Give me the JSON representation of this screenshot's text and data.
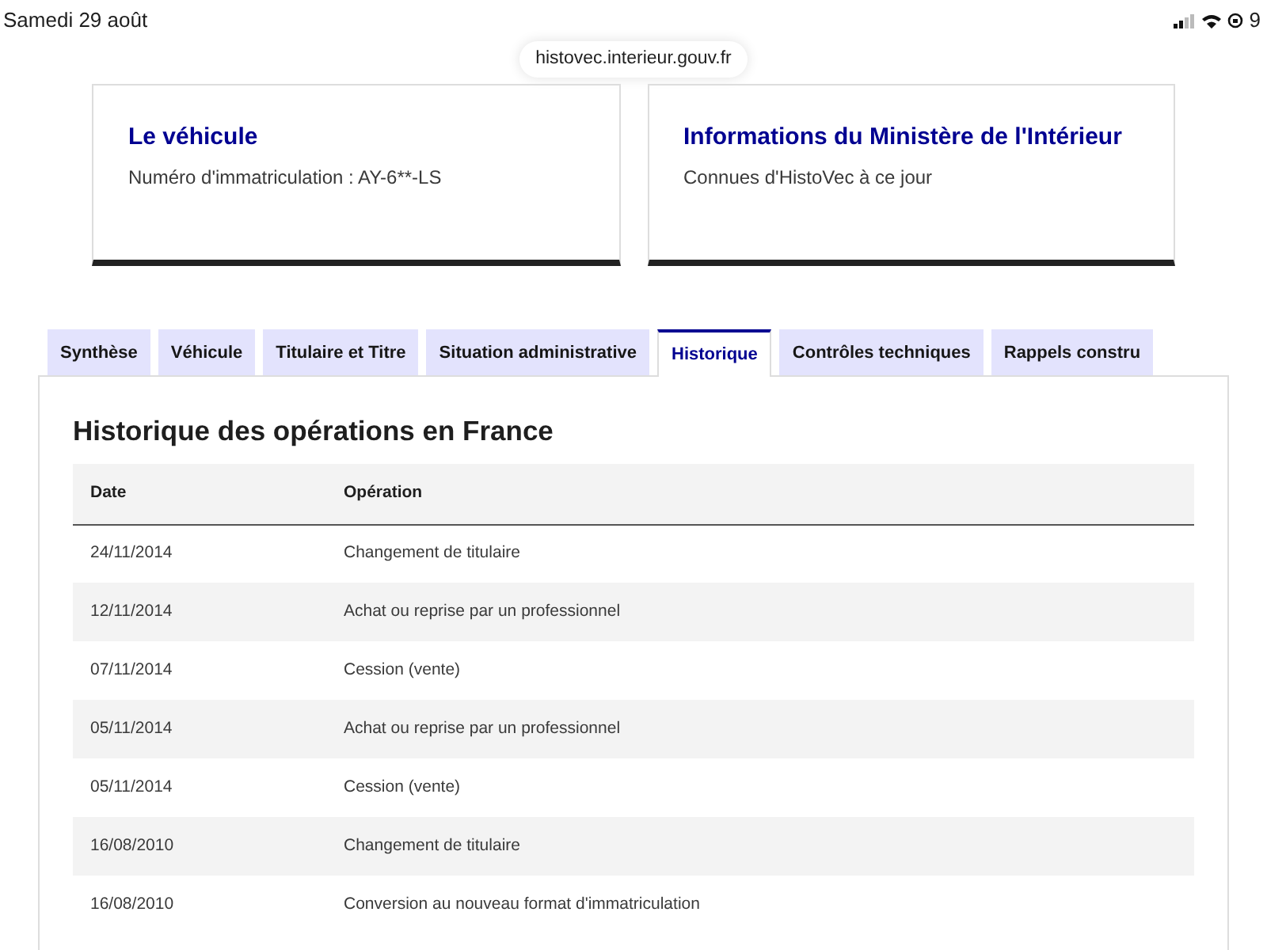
{
  "status_bar": {
    "date": "Samedi 29 août",
    "battery": "9"
  },
  "address_bar": {
    "url": "histovec.interieur.gouv.fr"
  },
  "cards": [
    {
      "title": "Le véhicule",
      "text": "Numéro d'immatriculation : AY-6**-LS"
    },
    {
      "title": "Informations du Ministère de l'Intérieur",
      "text": "Connues d'HistoVec à ce jour"
    }
  ],
  "tabs": [
    {
      "label": "Synthèse",
      "selected": false
    },
    {
      "label": "Véhicule",
      "selected": false
    },
    {
      "label": "Titulaire et Titre",
      "selected": false
    },
    {
      "label": "Situation administrative",
      "selected": false
    },
    {
      "label": "Historique",
      "selected": true
    },
    {
      "label": "Contrôles techniques",
      "selected": false
    },
    {
      "label": "Rappels constru",
      "selected": false
    }
  ],
  "section": {
    "title": "Historique des opérations en France"
  },
  "table": {
    "columns": [
      "Date",
      "Opération"
    ],
    "rows": [
      [
        "24/11/2014",
        "Changement de titulaire"
      ],
      [
        "12/11/2014",
        "Achat ou reprise par un professionnel"
      ],
      [
        "07/11/2014",
        "Cession (vente)"
      ],
      [
        "05/11/2014",
        "Achat ou reprise par un professionnel"
      ],
      [
        "05/11/2014",
        "Cession (vente)"
      ],
      [
        "16/08/2010",
        "Changement de titulaire"
      ],
      [
        "16/08/2010",
        "Conversion au nouveau format d'immatriculation"
      ]
    ]
  }
}
